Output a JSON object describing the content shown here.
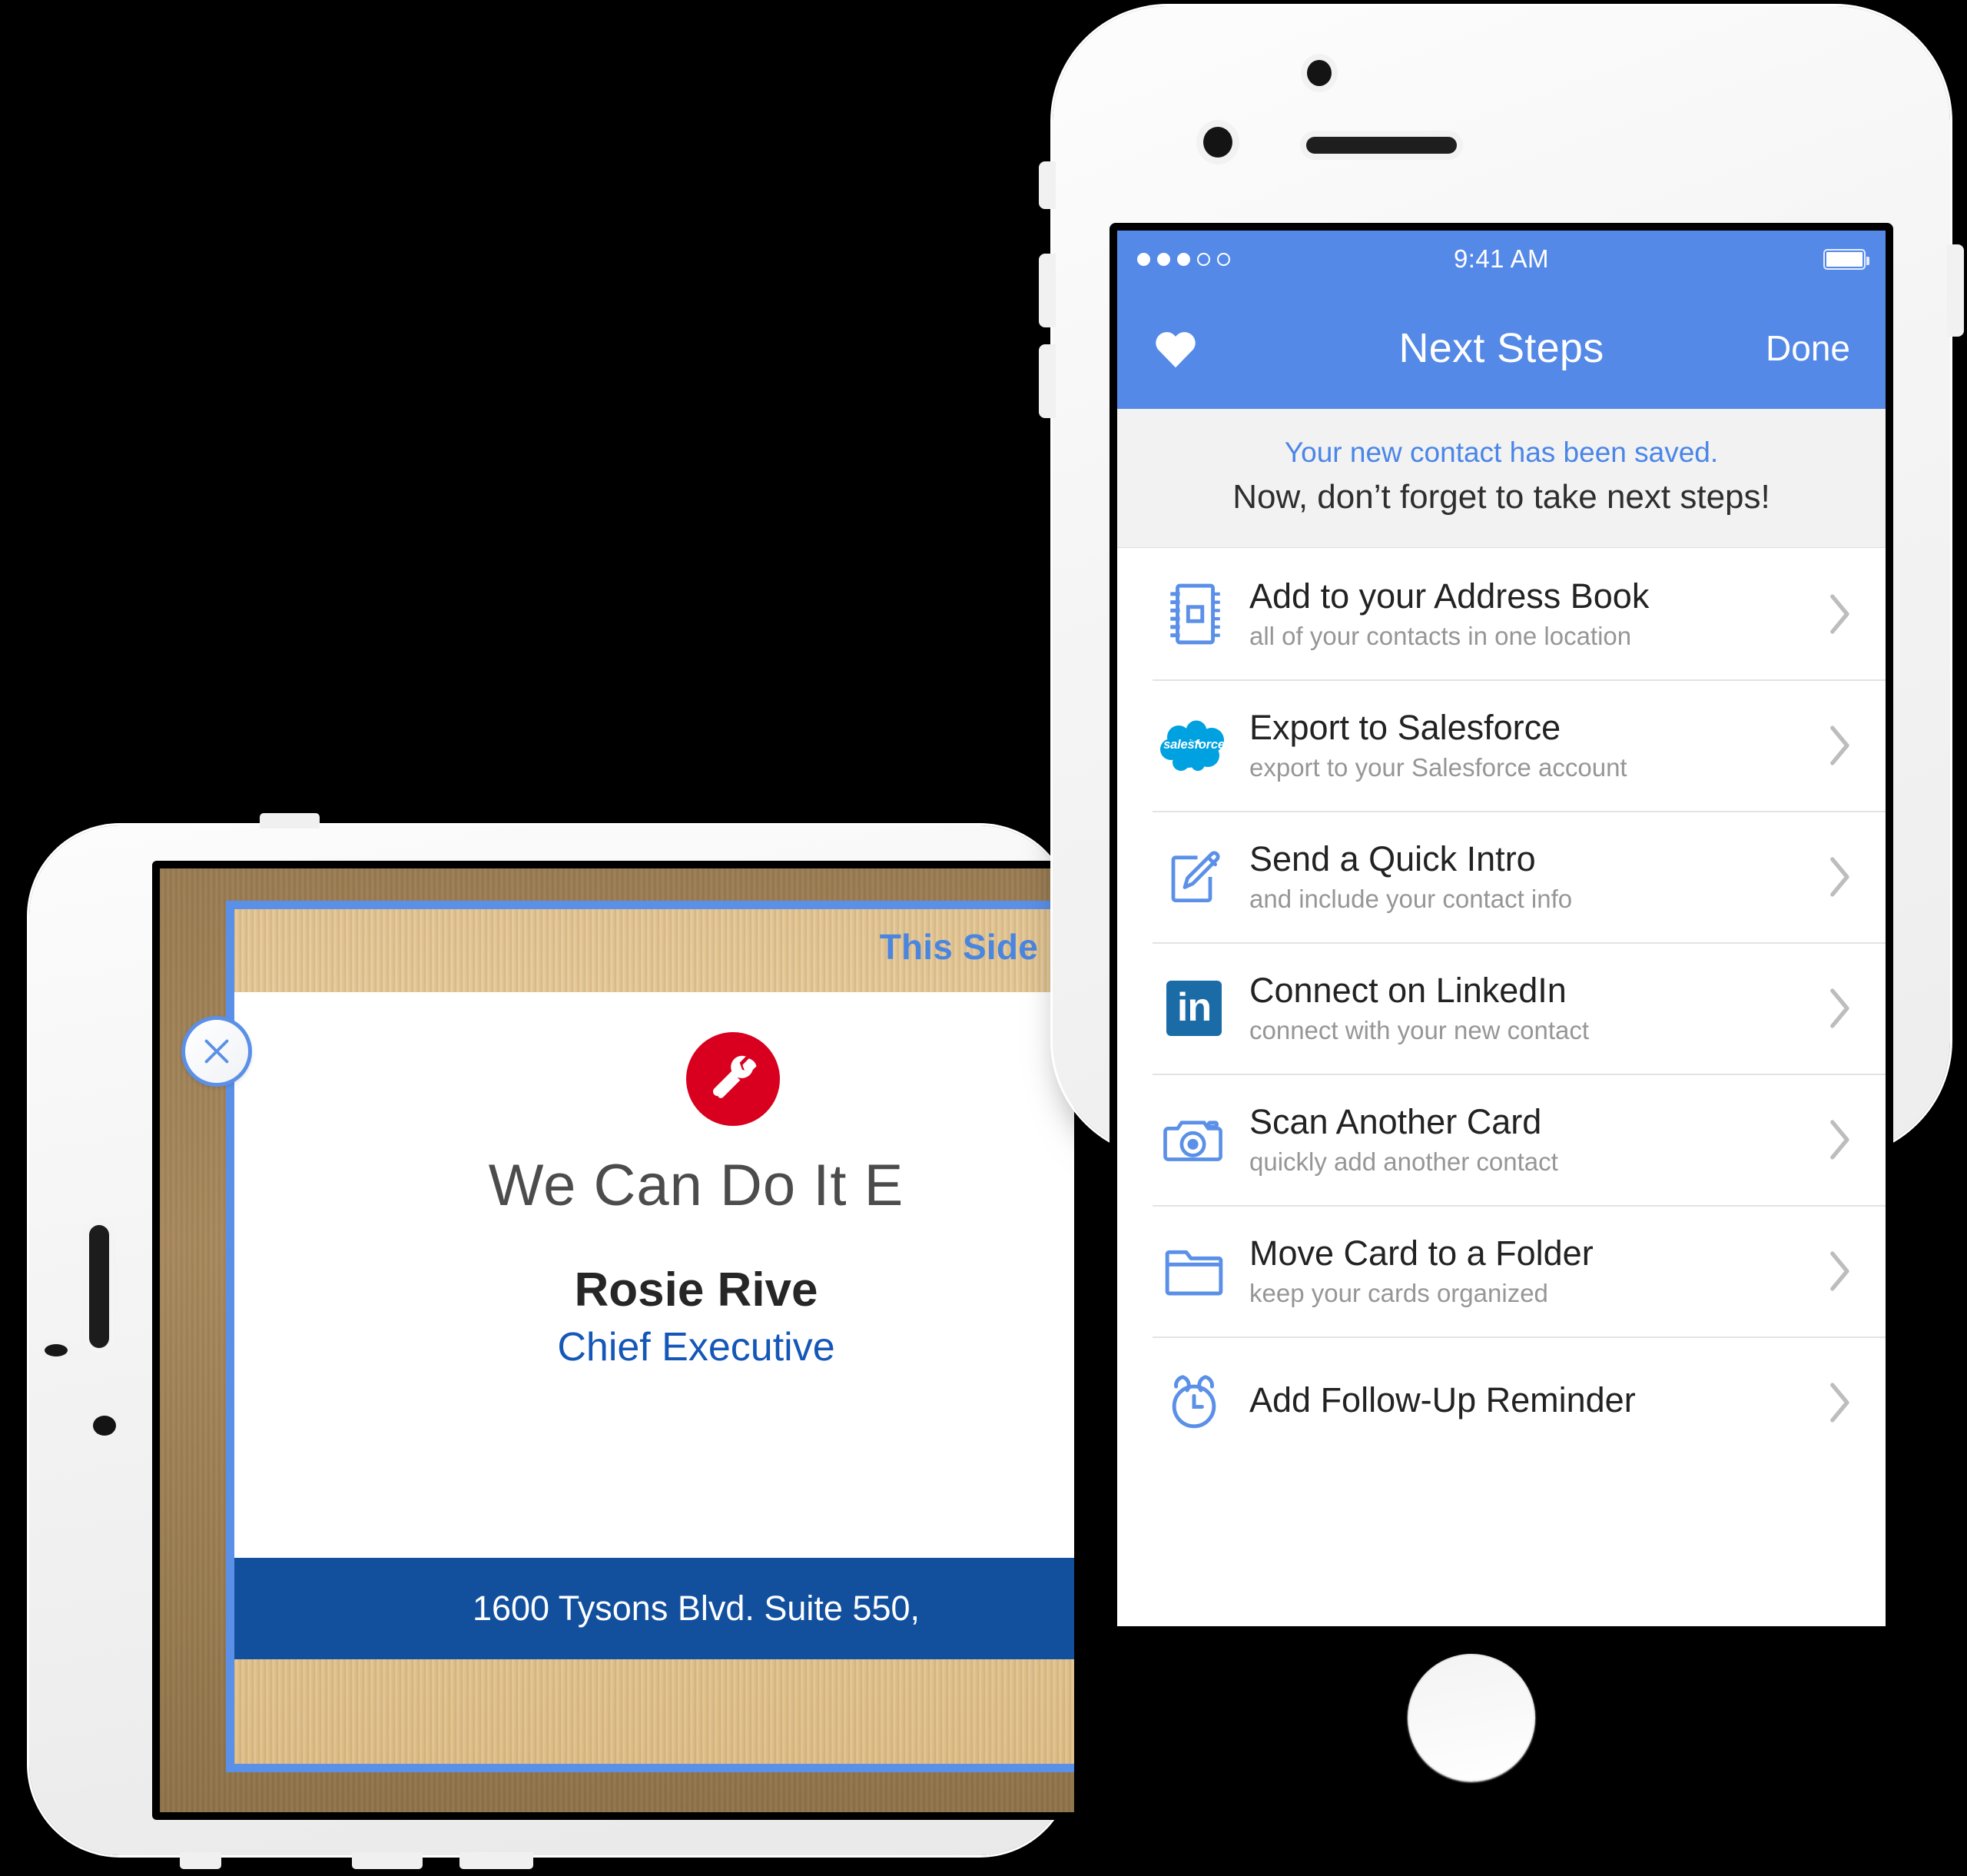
{
  "left_device": {
    "name": "iphone-landscape-scan-preview",
    "close_button_label": "×",
    "scan_overlay_label": "This Side",
    "business_card": {
      "headline": "We Can Do It E",
      "name": "Rosie Rive",
      "title": "Chief Executive",
      "address": "1600 Tysons Blvd. Suite 550,",
      "logo_icon": "wrench-icon",
      "logo_color": "#d8001e",
      "address_bar_color": "#12509e",
      "title_color": "#1557b8",
      "crop_frame_color": "#5b90e8"
    }
  },
  "right_device": {
    "status_bar": {
      "signal_dots_filled": 3,
      "signal_dots_total": 5,
      "time": "9:41 AM",
      "battery_icon": "battery-full-icon"
    },
    "nav": {
      "left_icon": "heart-icon",
      "title": "Next Steps",
      "done_label": "Done",
      "bar_color": "#5489e8"
    },
    "banner": {
      "line1": "Your new contact has been saved.",
      "line2": "Now, don’t forget to take next steps!",
      "line1_color": "#4a86e8"
    },
    "rows": [
      {
        "icon": "address-book-icon",
        "title": "Add to your Address Book",
        "subtitle": "all of your contacts in one location",
        "chevron": "chevron-right-icon"
      },
      {
        "icon": "salesforce-cloud-icon",
        "icon_label": "salesforce",
        "title": "Export to Salesforce",
        "subtitle": "export to your Salesforce account",
        "chevron": "chevron-right-icon"
      },
      {
        "icon": "compose-pencil-icon",
        "title": "Send a Quick Intro",
        "subtitle": "and include your contact info",
        "chevron": "chevron-right-icon"
      },
      {
        "icon": "linkedin-icon",
        "icon_label": "in",
        "title": "Connect on LinkedIn",
        "subtitle": "connect with your new contact",
        "chevron": "chevron-right-icon"
      },
      {
        "icon": "camera-icon",
        "title": "Scan Another Card",
        "subtitle": "quickly add another contact",
        "chevron": "chevron-right-icon"
      },
      {
        "icon": "folder-icon",
        "title": "Move Card to a Folder",
        "subtitle": "keep your cards organized",
        "chevron": "chevron-right-icon"
      },
      {
        "icon": "alarm-clock-icon",
        "title": "Add Follow-Up Reminder",
        "subtitle": "",
        "chevron": "chevron-right-icon"
      }
    ],
    "accent_blue": "#4a86e8",
    "icon_blue": "#5b90e8",
    "salesforce_blue": "#00a1e0",
    "linkedin_blue": "#1b6ba7"
  }
}
